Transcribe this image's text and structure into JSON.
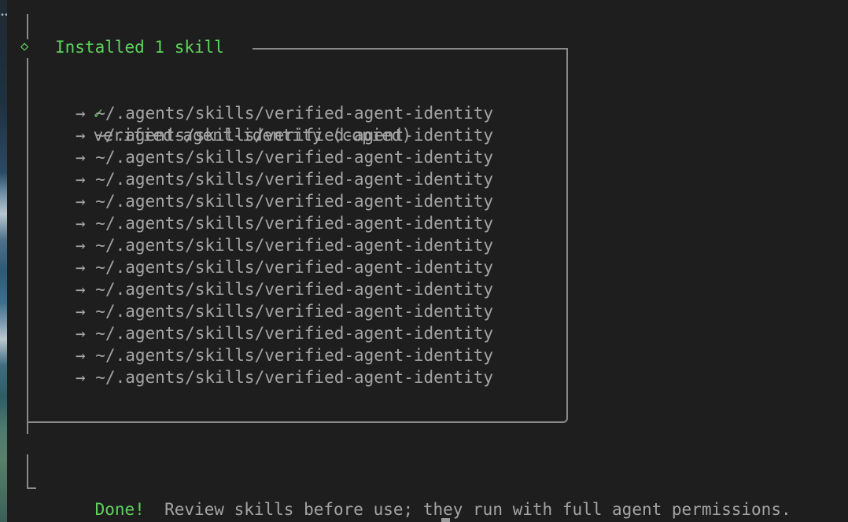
{
  "section": {
    "marker": "◇",
    "title": "Installed 1 skill"
  },
  "skill": {
    "check": "✓",
    "name": "verified-agent-identity (copied)"
  },
  "paths": [
    "→ ~/.agents/skills/verified-agent-identity",
    "→ ~/.agents/skills/verified-agent-identity",
    "→ ~/.agents/skills/verified-agent-identity",
    "→ ~/.agents/skills/verified-agent-identity",
    "→ ~/.agents/skills/verified-agent-identity",
    "→ ~/.agents/skills/verified-agent-identity",
    "→ ~/.agents/skills/verified-agent-identity",
    "→ ~/.agents/skills/verified-agent-identity",
    "→ ~/.agents/skills/verified-agent-identity",
    "→ ~/.agents/skills/verified-agent-identity",
    "→ ~/.agents/skills/verified-agent-identity",
    "→ ~/.agents/skills/verified-agent-identity",
    "→ ~/.agents/skills/verified-agent-identity"
  ],
  "footer": {
    "done": "Done!",
    "message": "Review skills before use; they run with full agent permissions."
  },
  "colors": {
    "accent_green": "#5fd35f",
    "text_gray": "#a4a4a4",
    "background": "#1e1e1e"
  }
}
